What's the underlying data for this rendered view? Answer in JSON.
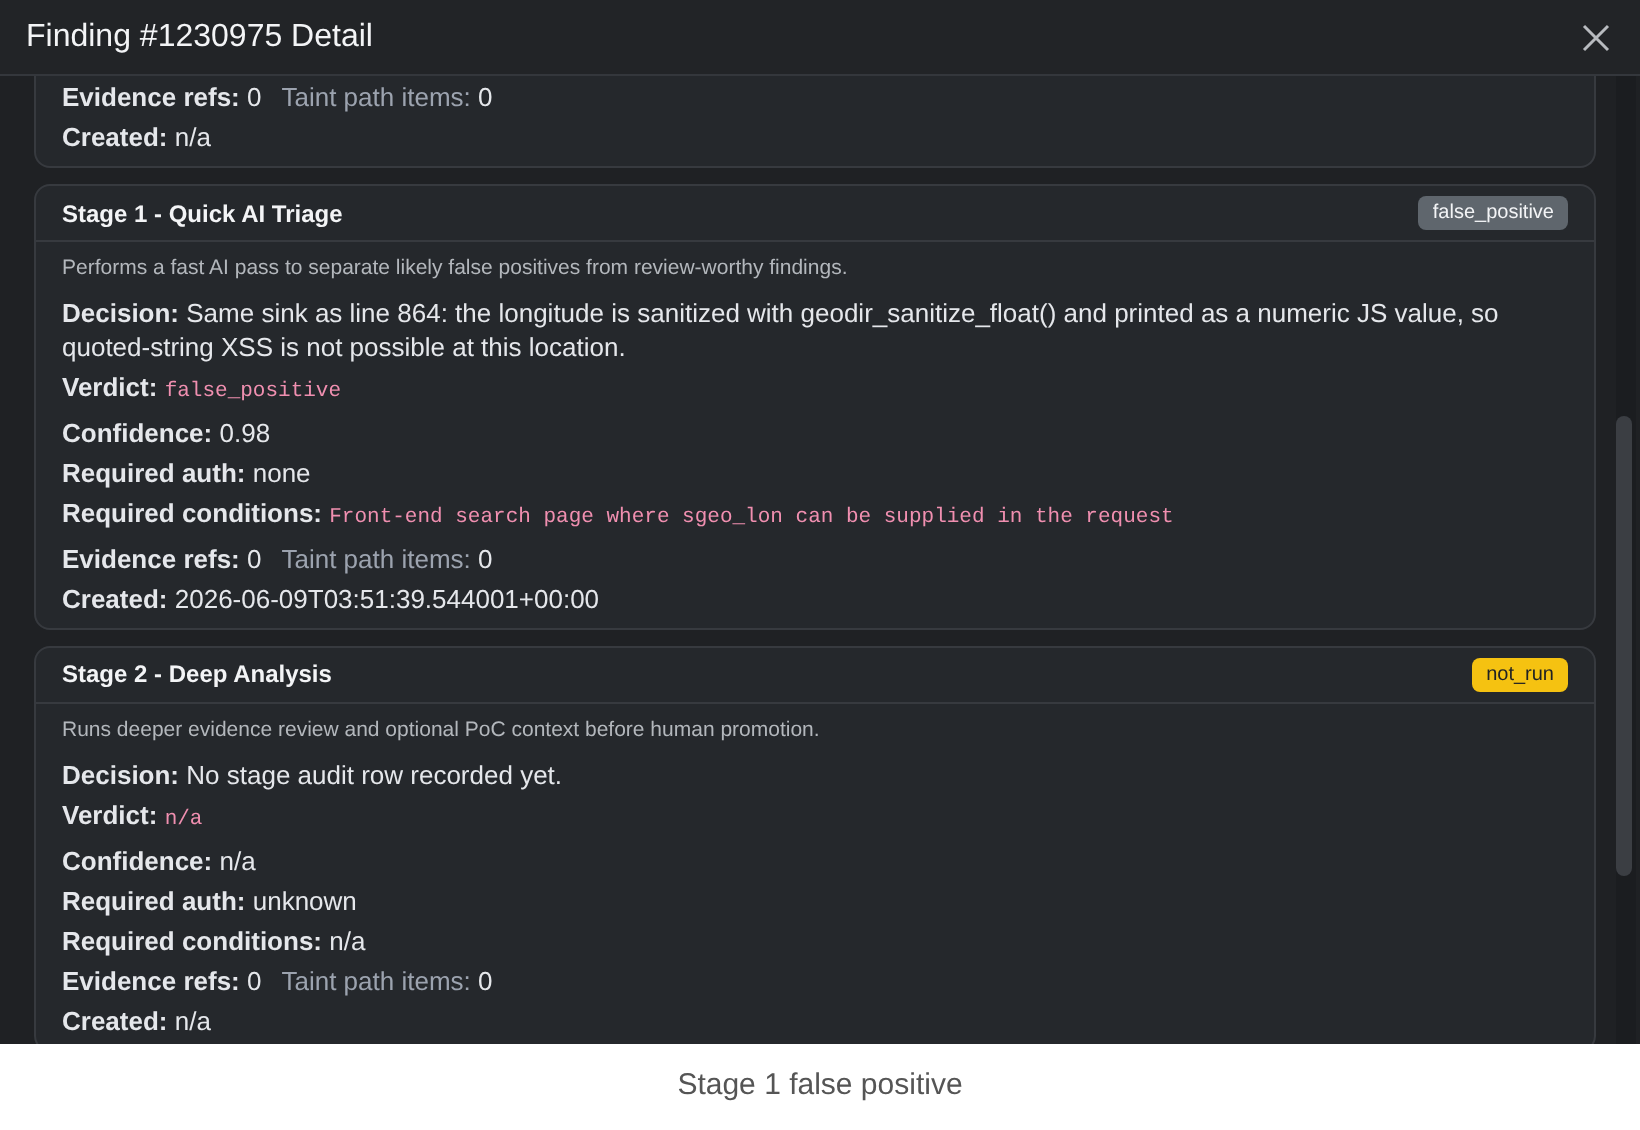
{
  "dialog": {
    "title": "Finding #1230975 Detail"
  },
  "partial_card": {
    "lines": [
      [
        {
          "label": "Evidence refs:",
          "value": "0",
          "kind": "text"
        },
        {
          "label": "Taint path items:",
          "value": "0",
          "kind": "muted"
        }
      ],
      [
        {
          "label": "Created:",
          "value": "n/a",
          "kind": "text"
        }
      ]
    ]
  },
  "stages": [
    {
      "title": "Stage 1 - Quick AI Triage",
      "badge": {
        "text": "false_positive",
        "kind": "neutral"
      },
      "description": "Performs a fast AI pass to separate likely false positives from review-worthy findings.",
      "lines": [
        [
          {
            "label": "Decision:",
            "value": "Same sink as line 864: the longitude is sanitized with geodir_sanitize_float() and printed as a numeric JS value, so quoted-string XSS is not possible at this location.",
            "kind": "text"
          }
        ],
        [
          {
            "label": "Verdict:",
            "value": "false_positive",
            "kind": "code"
          }
        ],
        [
          {
            "label": "Confidence:",
            "value": "0.98",
            "kind": "text"
          }
        ],
        [
          {
            "label": "Required auth:",
            "value": "none",
            "kind": "text"
          }
        ],
        [
          {
            "label": "Required conditions:",
            "value": "Front-end search page where sgeo_lon can be supplied in the request",
            "kind": "code"
          }
        ],
        [
          {
            "label": "Evidence refs:",
            "value": "0",
            "kind": "text"
          },
          {
            "label": "Taint path items:",
            "value": "0",
            "kind": "muted"
          }
        ],
        [
          {
            "label": "Created:",
            "value": "2026-06-09T03:51:39.544001+00:00",
            "kind": "text"
          }
        ]
      ]
    },
    {
      "title": "Stage 2 - Deep Analysis",
      "badge": {
        "text": "not_run",
        "kind": "warning"
      },
      "description": "Runs deeper evidence review and optional PoC context before human promotion.",
      "lines": [
        [
          {
            "label": "Decision:",
            "value": "No stage audit row recorded yet.",
            "kind": "text"
          }
        ],
        [
          {
            "label": "Verdict:",
            "value": "n/a",
            "kind": "code"
          }
        ],
        [
          {
            "label": "Confidence:",
            "value": "n/a",
            "kind": "text"
          }
        ],
        [
          {
            "label": "Required auth:",
            "value": "unknown",
            "kind": "text"
          }
        ],
        [
          {
            "label": "Required conditions:",
            "value": "n/a",
            "kind": "text"
          }
        ],
        [
          {
            "label": "Evidence refs:",
            "value": "0",
            "kind": "text"
          },
          {
            "label": "Taint path items:",
            "value": "0",
            "kind": "muted"
          }
        ],
        [
          {
            "label": "Created:",
            "value": "n/a",
            "kind": "text"
          }
        ]
      ]
    }
  ],
  "caption": "Stage 1 false positive"
}
